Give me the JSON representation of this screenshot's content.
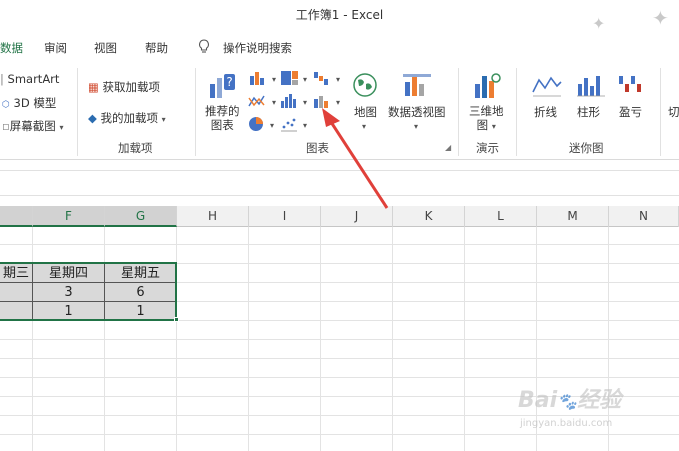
{
  "window": {
    "title": "工作簿1  -  Excel"
  },
  "tabs": [
    "数据",
    "审阅",
    "视图",
    "帮助"
  ],
  "tell_me": "操作说明搜索",
  "ribbon": {
    "illustrations": [
      "SmartArt",
      "3D 模型",
      "屏幕截图"
    ],
    "addins": {
      "get": "获取加载项",
      "mine": "我的加载项",
      "group": "加载项"
    },
    "charts": {
      "recommended_1": "推荐的",
      "recommended_2": "图表",
      "maps": "地图",
      "pivot": "数据透视图",
      "group": "图表"
    },
    "tours": {
      "map_1": "三维地",
      "map_2": "图",
      "group": "演示"
    },
    "sparklines": {
      "line": "折线",
      "column": "柱形",
      "winloss": "盈亏",
      "group": "迷你图"
    },
    "slicer_partial": "切"
  },
  "grid": {
    "columns": [
      "",
      "F",
      "G",
      "H",
      "I",
      "J",
      "K",
      "L",
      "M",
      "N"
    ]
  },
  "table": {
    "headers": [
      "期三",
      "星期四",
      "星期五"
    ],
    "rows": [
      [
        "",
        "3",
        "6"
      ],
      [
        "",
        "1",
        "1"
      ]
    ]
  },
  "watermark": {
    "url": "jingyan.baidu.com"
  },
  "colors": {
    "accent": "#217346",
    "arrow": "#e0403a"
  }
}
